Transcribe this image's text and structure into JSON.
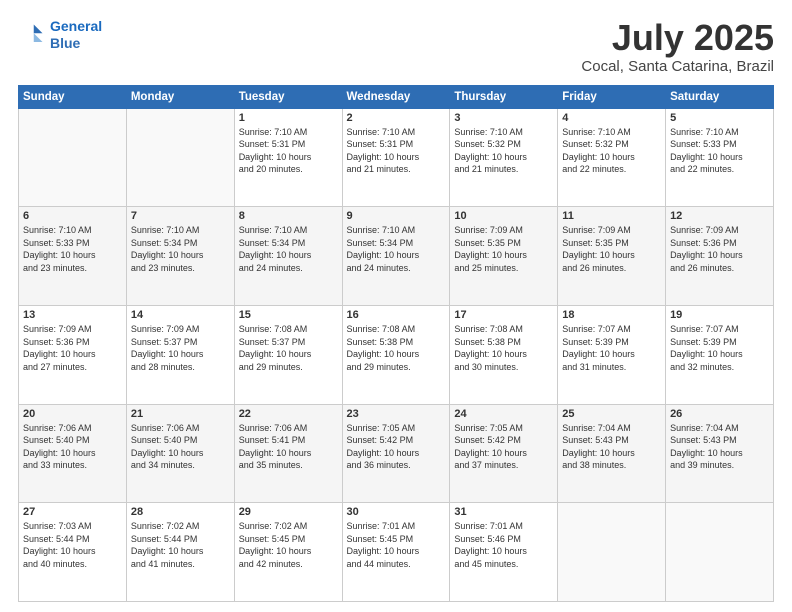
{
  "header": {
    "logo_line1": "General",
    "logo_line2": "Blue",
    "title": "July 2025",
    "location": "Cocal, Santa Catarina, Brazil"
  },
  "weekdays": [
    "Sunday",
    "Monday",
    "Tuesday",
    "Wednesday",
    "Thursday",
    "Friday",
    "Saturday"
  ],
  "weeks": [
    [
      {
        "day": "",
        "info": ""
      },
      {
        "day": "",
        "info": ""
      },
      {
        "day": "1",
        "info": "Sunrise: 7:10 AM\nSunset: 5:31 PM\nDaylight: 10 hours\nand 20 minutes."
      },
      {
        "day": "2",
        "info": "Sunrise: 7:10 AM\nSunset: 5:31 PM\nDaylight: 10 hours\nand 21 minutes."
      },
      {
        "day": "3",
        "info": "Sunrise: 7:10 AM\nSunset: 5:32 PM\nDaylight: 10 hours\nand 21 minutes."
      },
      {
        "day": "4",
        "info": "Sunrise: 7:10 AM\nSunset: 5:32 PM\nDaylight: 10 hours\nand 22 minutes."
      },
      {
        "day": "5",
        "info": "Sunrise: 7:10 AM\nSunset: 5:33 PM\nDaylight: 10 hours\nand 22 minutes."
      }
    ],
    [
      {
        "day": "6",
        "info": "Sunrise: 7:10 AM\nSunset: 5:33 PM\nDaylight: 10 hours\nand 23 minutes."
      },
      {
        "day": "7",
        "info": "Sunrise: 7:10 AM\nSunset: 5:34 PM\nDaylight: 10 hours\nand 23 minutes."
      },
      {
        "day": "8",
        "info": "Sunrise: 7:10 AM\nSunset: 5:34 PM\nDaylight: 10 hours\nand 24 minutes."
      },
      {
        "day": "9",
        "info": "Sunrise: 7:10 AM\nSunset: 5:34 PM\nDaylight: 10 hours\nand 24 minutes."
      },
      {
        "day": "10",
        "info": "Sunrise: 7:09 AM\nSunset: 5:35 PM\nDaylight: 10 hours\nand 25 minutes."
      },
      {
        "day": "11",
        "info": "Sunrise: 7:09 AM\nSunset: 5:35 PM\nDaylight: 10 hours\nand 26 minutes."
      },
      {
        "day": "12",
        "info": "Sunrise: 7:09 AM\nSunset: 5:36 PM\nDaylight: 10 hours\nand 26 minutes."
      }
    ],
    [
      {
        "day": "13",
        "info": "Sunrise: 7:09 AM\nSunset: 5:36 PM\nDaylight: 10 hours\nand 27 minutes."
      },
      {
        "day": "14",
        "info": "Sunrise: 7:09 AM\nSunset: 5:37 PM\nDaylight: 10 hours\nand 28 minutes."
      },
      {
        "day": "15",
        "info": "Sunrise: 7:08 AM\nSunset: 5:37 PM\nDaylight: 10 hours\nand 29 minutes."
      },
      {
        "day": "16",
        "info": "Sunrise: 7:08 AM\nSunset: 5:38 PM\nDaylight: 10 hours\nand 29 minutes."
      },
      {
        "day": "17",
        "info": "Sunrise: 7:08 AM\nSunset: 5:38 PM\nDaylight: 10 hours\nand 30 minutes."
      },
      {
        "day": "18",
        "info": "Sunrise: 7:07 AM\nSunset: 5:39 PM\nDaylight: 10 hours\nand 31 minutes."
      },
      {
        "day": "19",
        "info": "Sunrise: 7:07 AM\nSunset: 5:39 PM\nDaylight: 10 hours\nand 32 minutes."
      }
    ],
    [
      {
        "day": "20",
        "info": "Sunrise: 7:06 AM\nSunset: 5:40 PM\nDaylight: 10 hours\nand 33 minutes."
      },
      {
        "day": "21",
        "info": "Sunrise: 7:06 AM\nSunset: 5:40 PM\nDaylight: 10 hours\nand 34 minutes."
      },
      {
        "day": "22",
        "info": "Sunrise: 7:06 AM\nSunset: 5:41 PM\nDaylight: 10 hours\nand 35 minutes."
      },
      {
        "day": "23",
        "info": "Sunrise: 7:05 AM\nSunset: 5:42 PM\nDaylight: 10 hours\nand 36 minutes."
      },
      {
        "day": "24",
        "info": "Sunrise: 7:05 AM\nSunset: 5:42 PM\nDaylight: 10 hours\nand 37 minutes."
      },
      {
        "day": "25",
        "info": "Sunrise: 7:04 AM\nSunset: 5:43 PM\nDaylight: 10 hours\nand 38 minutes."
      },
      {
        "day": "26",
        "info": "Sunrise: 7:04 AM\nSunset: 5:43 PM\nDaylight: 10 hours\nand 39 minutes."
      }
    ],
    [
      {
        "day": "27",
        "info": "Sunrise: 7:03 AM\nSunset: 5:44 PM\nDaylight: 10 hours\nand 40 minutes."
      },
      {
        "day": "28",
        "info": "Sunrise: 7:02 AM\nSunset: 5:44 PM\nDaylight: 10 hours\nand 41 minutes."
      },
      {
        "day": "29",
        "info": "Sunrise: 7:02 AM\nSunset: 5:45 PM\nDaylight: 10 hours\nand 42 minutes."
      },
      {
        "day": "30",
        "info": "Sunrise: 7:01 AM\nSunset: 5:45 PM\nDaylight: 10 hours\nand 44 minutes."
      },
      {
        "day": "31",
        "info": "Sunrise: 7:01 AM\nSunset: 5:46 PM\nDaylight: 10 hours\nand 45 minutes."
      },
      {
        "day": "",
        "info": ""
      },
      {
        "day": "",
        "info": ""
      }
    ]
  ]
}
